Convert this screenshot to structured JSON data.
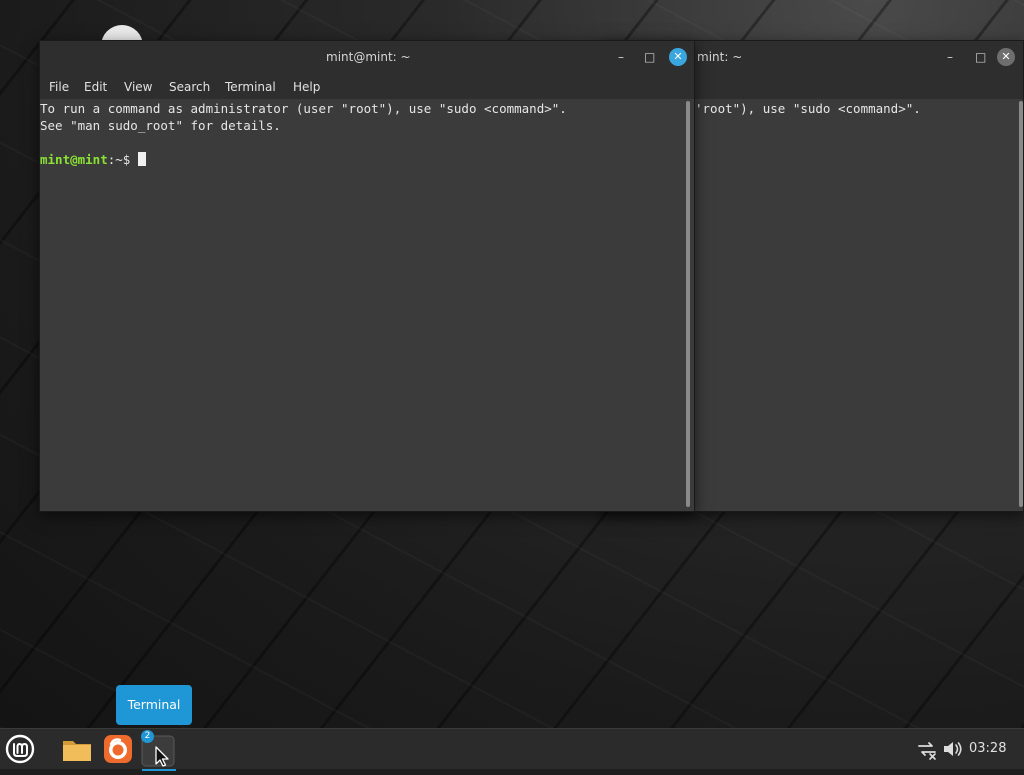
{
  "terminal_front": {
    "title": "mint@mint: ~",
    "menu": [
      "File",
      "Edit",
      "View",
      "Search",
      "Terminal",
      "Help"
    ],
    "line1": "To run a command as administrator (user \"root\"), use \"sudo <command>\".",
    "line2": "See \"man sudo_root\" for details.",
    "prompt_user": "mint@mint",
    "prompt_rest": ":~$ "
  },
  "terminal_back": {
    "title": "mint: ~",
    "line1": "'root\"), use \"sudo <command>\"."
  },
  "tooltip": {
    "text": "Terminal"
  },
  "taskbar": {
    "terminal_badge": "2",
    "clock": "03:28"
  },
  "colors": {
    "accent": "#1f97d6",
    "prompt_green": "#8ae234",
    "close_active": "#3aa6e0"
  },
  "icons": {
    "menu": "linux-mint-logo-icon",
    "files": "folder-icon",
    "browser": "firefox-icon",
    "terminal": "terminal-icon",
    "network": "network-disconnected-icon",
    "volume": "volume-icon"
  }
}
